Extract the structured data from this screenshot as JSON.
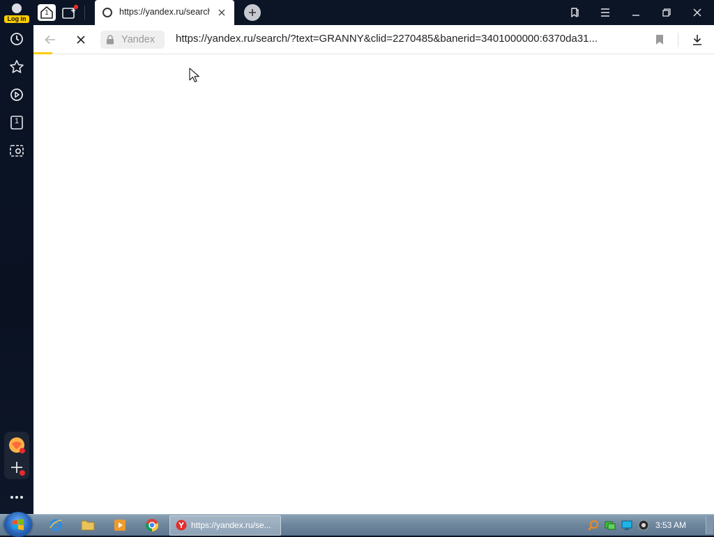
{
  "sidebar": {
    "login_label": "Log in",
    "icons": [
      "history-icon",
      "bookmarks-star-icon",
      "video-play-icon",
      "collection-icon",
      "screenshot-camera-icon"
    ],
    "collection_badge": "1",
    "bottom_icons": [
      "messenger-icon",
      "add-service-icon"
    ],
    "more_label": "more-dots-icon"
  },
  "tabstrip": {
    "home_badge": "1",
    "active_tab": {
      "title": "https://yandex.ru/search/?text=GRANNY",
      "loading": true
    }
  },
  "toolbar": {
    "site_name": "Yandex",
    "url": "https://yandex.ru/search/?text=GRANNY&clid=2270485&banerid=3401000000:6370da31...",
    "accent_color": "#ffcc00"
  },
  "taskbar": {
    "apps": [
      "internet-explorer-icon",
      "file-explorer-icon",
      "media-player-icon",
      "chrome-icon"
    ],
    "active_task_label": "https://yandex.ru/se...",
    "clock": "3:53 AM"
  }
}
